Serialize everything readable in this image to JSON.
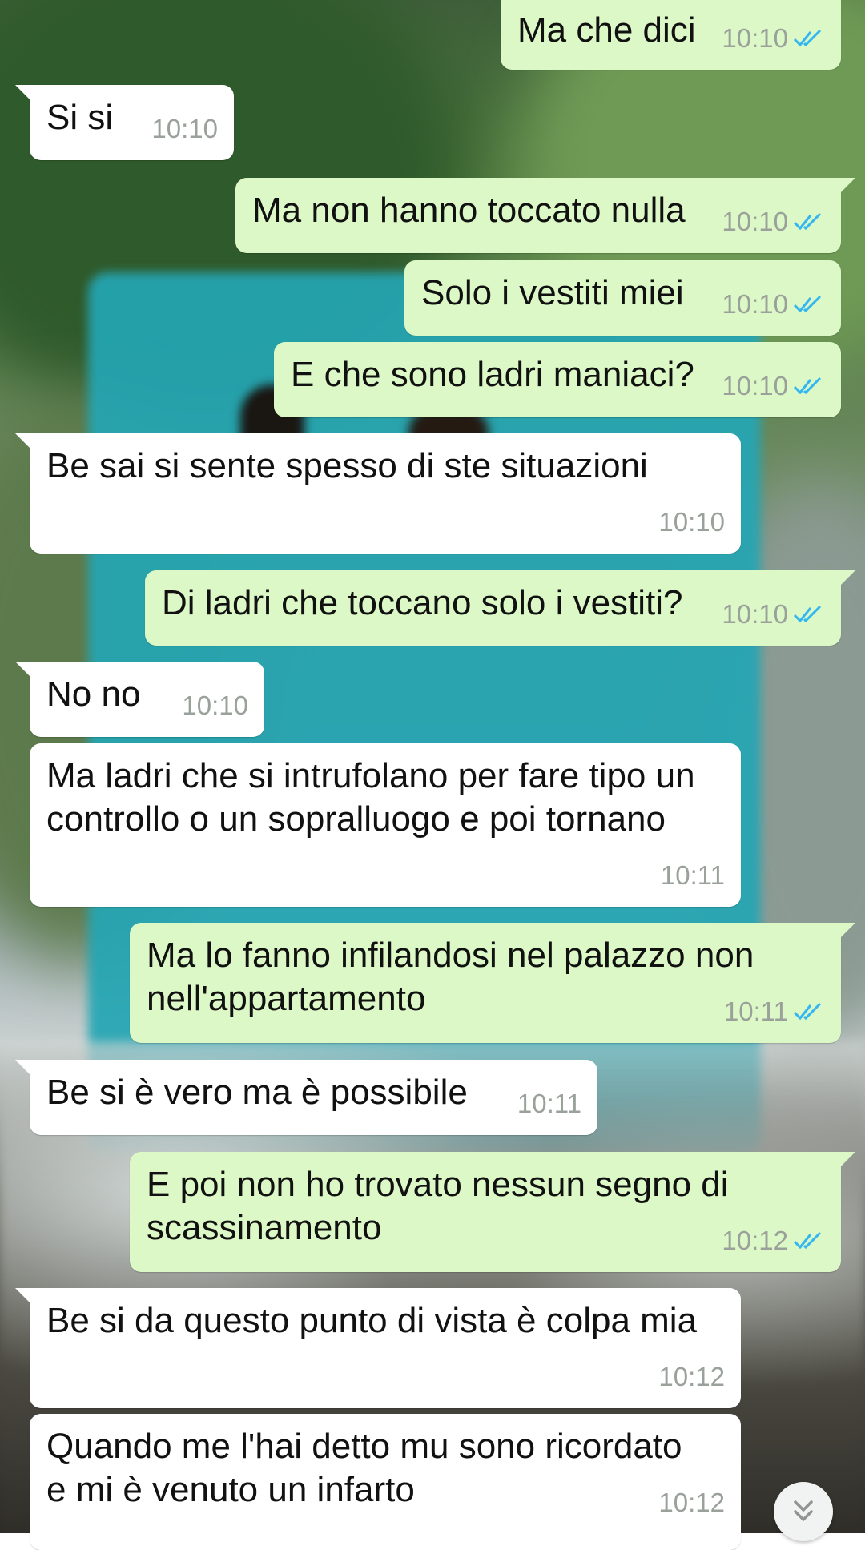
{
  "messages": [
    {
      "text": "Ma che dici",
      "time": "10:10"
    },
    {
      "text": "Si si",
      "time": "10:10"
    },
    {
      "text": "Ma non hanno toccato nulla",
      "time": "10:10"
    },
    {
      "text": "Solo i vestiti miei",
      "time": "10:10"
    },
    {
      "text": "E che sono ladri maniaci?",
      "time": "10:10"
    },
    {
      "text": "Be sai si sente spesso di ste situazioni",
      "time": "10:10"
    },
    {
      "text": "Di ladri che toccano solo i vestiti?",
      "time": "10:10"
    },
    {
      "text": "No no",
      "time": "10:10"
    },
    {
      "text": "Ma ladri che si intrufolano per fare tipo un\ncontrollo o un sopralluogo e poi tornano",
      "time": "10:11"
    },
    {
      "text": "Ma lo fanno infilandosi nel palazzo non\nnell'appartamento",
      "time": "10:11"
    },
    {
      "text": "Be si è vero ma è possibile",
      "time": "10:11"
    },
    {
      "text": "E poi non ho trovato nessun segno di\nscassinamento",
      "time": "10:12"
    },
    {
      "text": "Be si da questo punto di vista è colpa mia",
      "time": "10:12"
    },
    {
      "text": "Quando me l'hai detto mu sono ricordato\ne mi è venuto un infarto",
      "time": "10:12"
    }
  ],
  "icons": {
    "read_receipt": "double-check-icon",
    "scroll_down": "chevrons-down-icon"
  },
  "colors": {
    "outgoing_bubble": "#dcf8c6",
    "incoming_bubble": "#ffffff",
    "read_tick": "#34b7f1",
    "timestamp": "#9aa09a"
  }
}
